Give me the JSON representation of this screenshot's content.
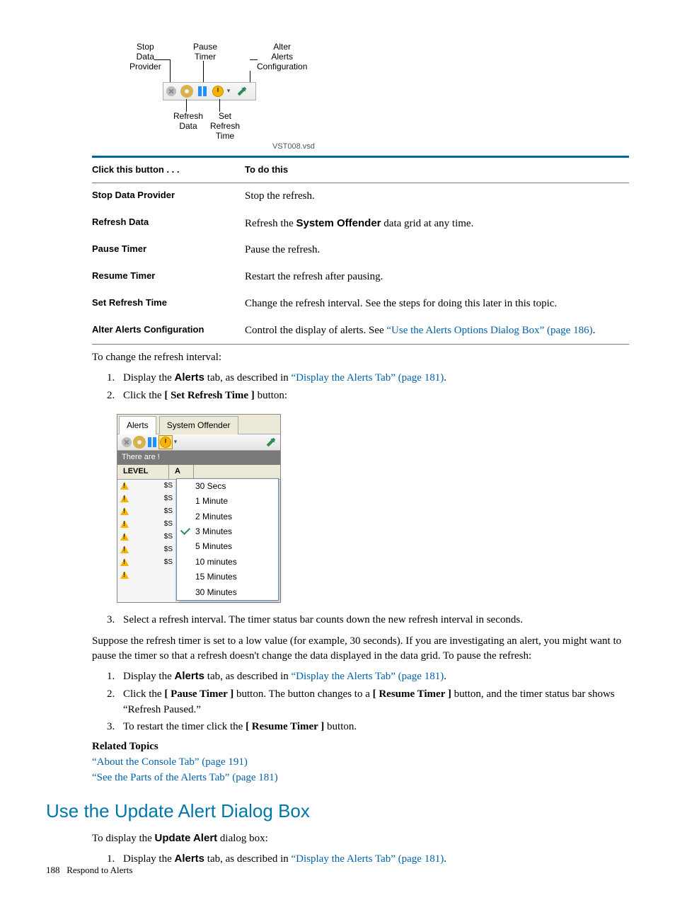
{
  "fig1": {
    "labels": {
      "stop": "Stop\nData\nProvider",
      "pause": "Pause\nTimer",
      "alter": "Alter\nAlerts\nConfiguration",
      "refresh": "Refresh\nData",
      "set": "Set\nRefresh\nTime"
    },
    "caption": "VST008.vsd"
  },
  "table": {
    "h1": "Click this button . . .",
    "h2": "To do this",
    "rows": [
      {
        "b": "Stop Data Provider",
        "d": "Stop the refresh."
      },
      {
        "b": "Refresh Data",
        "d_pre": "Refresh the ",
        "d_bold": "System Offender",
        "d_post": " data grid at any time."
      },
      {
        "b": "Pause Timer",
        "d": "Pause the refresh."
      },
      {
        "b": "Resume Timer",
        "d": "Restart the refresh after pausing."
      },
      {
        "b": "Set Refresh Time",
        "d": "Change the refresh interval. See the steps for doing this later in this topic."
      },
      {
        "b": "Alter Alerts Configuration",
        "d_pre": "Control the display of alerts. See ",
        "d_link": "“Use the Alerts Options Dialog Box” (page 186)",
        "d_post": "."
      }
    ]
  },
  "para1": "To change the refresh interval:",
  "list1": {
    "i1_pre": "Display the ",
    "i1_bold": "Alerts",
    "i1_mid": " tab, as described in ",
    "i1_link": "“Display the Alerts Tab” (page 181)",
    "i1_post": ".",
    "i2_pre": "Click the ",
    "i2_bold": "[ Set Refresh Time ]",
    "i2_post": " button:"
  },
  "fig2": {
    "tab1": "Alerts",
    "tab2": "System Offender",
    "hdr": "There are !",
    "col1": "LEVEL",
    "col2": "A",
    "ss": "$S",
    "menu": [
      "30 Secs",
      "1 Minute",
      "2 Minutes",
      "3 Minutes",
      "5 Minutes",
      "10 minutes",
      "15 Minutes",
      "30 Minutes"
    ],
    "checked_index": 3
  },
  "list1b": {
    "i3": "Select a refresh interval. The timer status bar counts down the new refresh interval in seconds."
  },
  "para2": "Suppose the refresh timer is set to a low value (for example, 30 seconds). If you are investigating an alert, you might want to pause the timer so that a refresh doesn't change the data displayed in the data grid. To pause the refresh:",
  "list2": {
    "i1_pre": "Display the ",
    "i1_bold": "Alerts",
    "i1_mid": " tab, as described in ",
    "i1_link": "“Display the Alerts Tab” (page 181)",
    "i1_post": ".",
    "i2_pre": "Click the ",
    "i2_bold1": "[ Pause Timer ]",
    "i2_mid": " button. The button changes to a ",
    "i2_bold2": "[ Resume Timer ]",
    "i2_post": " button, and the timer status bar shows “Refresh Paused.”",
    "i3_pre": "To restart the timer click the ",
    "i3_bold": "[ Resume Timer ]",
    "i3_post": " button."
  },
  "related": {
    "title": "Related Topics",
    "l1": "“About the Console Tab” (page 191)",
    "l2": "“See the Parts of the Alerts Tab” (page 181)"
  },
  "h2": "Use the Update Alert Dialog Box",
  "para3_pre": "To display the ",
  "para3_bold": "Update Alert",
  "para3_post": " dialog box:",
  "list3": {
    "i1_pre": "Display the ",
    "i1_bold": "Alerts",
    "i1_mid": " tab, as described in ",
    "i1_link": "“Display the Alerts Tab” (page 181)",
    "i1_post": "."
  },
  "footer": {
    "page": "188",
    "title": "Respond to Alerts"
  }
}
